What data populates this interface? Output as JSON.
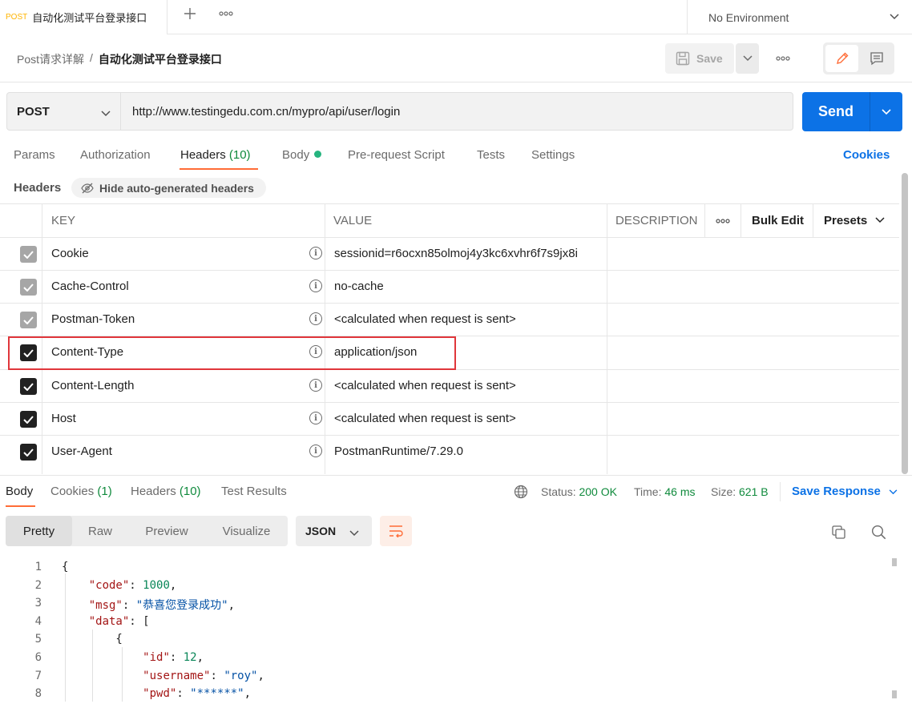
{
  "tab": {
    "method": "POST",
    "title": "自动化测试平台登录接口"
  },
  "environment": "No Environment",
  "breadcrumb": {
    "parent": "Post请求详解",
    "sep": "/",
    "current": "自动化测试平台登录接口"
  },
  "toolbar": {
    "save_label": "Save"
  },
  "request": {
    "method": "POST",
    "url": "http://www.testingedu.com.cn/mypro/api/user/login",
    "send_label": "Send"
  },
  "req_tabs": {
    "params": "Params",
    "authorization": "Authorization",
    "headers": "Headers",
    "headers_count": "(10)",
    "body": "Body",
    "prerequest": "Pre-request Script",
    "tests": "Tests",
    "settings": "Settings",
    "cookies": "Cookies"
  },
  "headers_section": {
    "label": "Headers",
    "hide_auto": "Hide auto-generated headers"
  },
  "table": {
    "key_col": "KEY",
    "value_col": "VALUE",
    "desc_col": "DESCRIPTION",
    "bulk_edit": "Bulk Edit",
    "presets": "Presets",
    "rows": [
      {
        "key": "Cookie",
        "value": "sessionid=r6ocxn85olmoj4y3kc6xvhr6f7s9jx8i",
        "checked": true,
        "auto": true
      },
      {
        "key": "Cache-Control",
        "value": "no-cache",
        "checked": true,
        "auto": true
      },
      {
        "key": "Postman-Token",
        "value": "<calculated when request is sent>",
        "checked": true,
        "auto": true
      },
      {
        "key": "Content-Type",
        "value": "application/json",
        "checked": true,
        "auto": false
      },
      {
        "key": "Content-Length",
        "value": "<calculated when request is sent>",
        "checked": true,
        "auto": false
      },
      {
        "key": "Host",
        "value": "<calculated when request is sent>",
        "checked": true,
        "auto": false
      },
      {
        "key": "User-Agent",
        "value": "PostmanRuntime/7.29.0",
        "checked": true,
        "auto": false
      }
    ]
  },
  "response": {
    "tabs": {
      "body": "Body",
      "cookies": "Cookies",
      "cookies_count": "(1)",
      "headers": "Headers",
      "headers_count": "(10)",
      "tests": "Test Results"
    },
    "status_label": "Status:",
    "status_value": "200 OK",
    "time_label": "Time:",
    "time_value": "46 ms",
    "size_label": "Size:",
    "size_value": "621 B",
    "save_response": "Save Response",
    "view_opts": [
      "Pretty",
      "Raw",
      "Preview",
      "Visualize"
    ],
    "format": "JSON",
    "code_lines": [
      {
        "n": "1",
        "parts": [
          [
            "p",
            "{"
          ]
        ]
      },
      {
        "n": "2",
        "parts": [
          [
            "p",
            "    "
          ],
          [
            "k",
            "\"code\""
          ],
          [
            "p",
            ": "
          ],
          [
            "n",
            "1000"
          ],
          [
            "p",
            ","
          ]
        ]
      },
      {
        "n": "3",
        "parts": [
          [
            "p",
            "    "
          ],
          [
            "k",
            "\"msg\""
          ],
          [
            "p",
            ": "
          ],
          [
            "s",
            "\"恭喜您登录成功\""
          ],
          [
            "p",
            ","
          ]
        ]
      },
      {
        "n": "4",
        "parts": [
          [
            "p",
            "    "
          ],
          [
            "k",
            "\"data\""
          ],
          [
            "p",
            ": ["
          ]
        ]
      },
      {
        "n": "5",
        "parts": [
          [
            "p",
            "        {"
          ]
        ]
      },
      {
        "n": "6",
        "parts": [
          [
            "p",
            "            "
          ],
          [
            "k",
            "\"id\""
          ],
          [
            "p",
            ": "
          ],
          [
            "n",
            "12"
          ],
          [
            "p",
            ","
          ]
        ]
      },
      {
        "n": "7",
        "parts": [
          [
            "p",
            "            "
          ],
          [
            "k",
            "\"username\""
          ],
          [
            "p",
            ": "
          ],
          [
            "s",
            "\"roy\""
          ],
          [
            "p",
            ","
          ]
        ]
      },
      {
        "n": "8",
        "parts": [
          [
            "p",
            "            "
          ],
          [
            "k",
            "\"pwd\""
          ],
          [
            "p",
            ": "
          ],
          [
            "s",
            "\"******\""
          ],
          [
            "p",
            ","
          ]
        ]
      }
    ]
  },
  "colors": {
    "accent": "#ff6c37",
    "primary": "#0c72e6",
    "success": "#0f8a3c",
    "highlight_border": "#e0363b"
  }
}
